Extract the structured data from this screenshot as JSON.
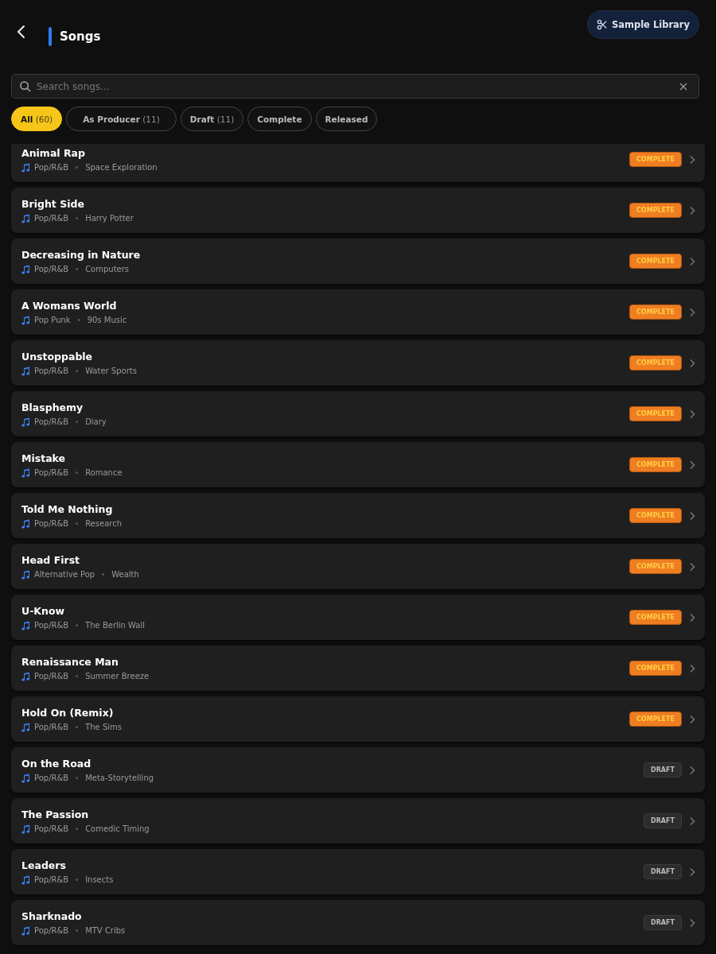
{
  "header": {
    "title": "Songs",
    "sample_button": "Sample Library"
  },
  "search": {
    "placeholder": "Search songs..."
  },
  "filters": [
    {
      "label": "All",
      "count": "(60)",
      "selected": true
    },
    {
      "label": "As Producer",
      "count": "(11)",
      "selected": false
    },
    {
      "label": "Draft",
      "count": "(11)",
      "selected": false
    },
    {
      "label": "Complete",
      "selected": false
    },
    {
      "label": "Released",
      "selected": false
    }
  ],
  "songs": [
    {
      "title": "Animal Rap",
      "genre": "Pop/R&B",
      "topic": "Space Exploration",
      "status": {
        "kind": "complete",
        "label": "COMPLETE"
      }
    },
    {
      "title": "Bright Side",
      "genre": "Pop/R&B",
      "topic": "Harry Potter",
      "status": {
        "kind": "complete",
        "label": "COMPLETE"
      }
    },
    {
      "title": "Decreasing in Nature",
      "genre": "Pop/R&B",
      "topic": "Computers",
      "status": {
        "kind": "complete",
        "label": "COMPLETE"
      }
    },
    {
      "title": "A Womans World",
      "genre": "Pop Punk",
      "topic": "90s Music",
      "status": {
        "kind": "complete",
        "label": "COMPLETE"
      }
    },
    {
      "title": "Unstoppable",
      "genre": "Pop/R&B",
      "topic": "Water Sports",
      "status": {
        "kind": "complete",
        "label": "COMPLETE"
      }
    },
    {
      "title": "Blasphemy",
      "genre": "Pop/R&B",
      "topic": "Diary",
      "status": {
        "kind": "complete",
        "label": "COMPLETE"
      }
    },
    {
      "title": "Mistake",
      "genre": "Pop/R&B",
      "topic": "Romance",
      "status": {
        "kind": "complete",
        "label": "COMPLETE"
      }
    },
    {
      "title": "Told Me Nothing",
      "genre": "Pop/R&B",
      "topic": "Research",
      "status": {
        "kind": "complete",
        "label": "COMPLETE"
      }
    },
    {
      "title": "Head First",
      "genre": "Alternative Pop",
      "topic": "Wealth",
      "status": {
        "kind": "complete",
        "label": "COMPLETE"
      }
    },
    {
      "title": "U-Know",
      "genre": "Pop/R&B",
      "topic": "The Berlin Wall",
      "status": {
        "kind": "complete",
        "label": "COMPLETE"
      }
    },
    {
      "title": "Renaissance Man",
      "genre": "Pop/R&B",
      "topic": "Summer Breeze",
      "status": {
        "kind": "complete",
        "label": "COMPLETE"
      }
    },
    {
      "title": "Hold On (Remix)",
      "genre": "Pop/R&B",
      "topic": "The Sims",
      "status": {
        "kind": "complete",
        "label": "COMPLETE"
      }
    },
    {
      "title": "On the Road",
      "genre": "Pop/R&B",
      "topic": "Meta-Storytelling",
      "status": {
        "kind": "draft",
        "label": "DRAFT"
      }
    },
    {
      "title": "The Passion",
      "genre": "Pop/R&B",
      "topic": "Comedic Timing",
      "status": {
        "kind": "draft",
        "label": "DRAFT"
      }
    },
    {
      "title": "Leaders",
      "genre": "Pop/R&B",
      "topic": "Insects",
      "status": {
        "kind": "draft",
        "label": "DRAFT"
      }
    },
    {
      "title": "Sharknado",
      "genre": "Pop/R&B",
      "topic": "MTV Cribs",
      "status": {
        "kind": "draft",
        "label": "DRAFT"
      }
    }
  ]
}
